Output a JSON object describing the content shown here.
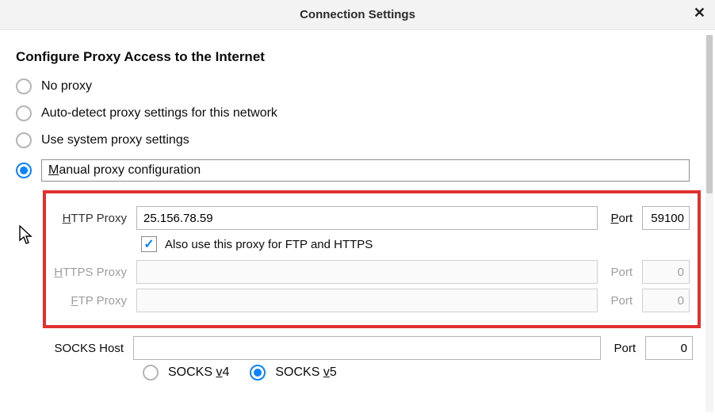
{
  "dialog": {
    "title": "Connection Settings"
  },
  "section": {
    "heading": "Configure Proxy Access to the Internet"
  },
  "radios": {
    "no_proxy": "No proxy",
    "auto_detect": "Auto-detect proxy settings for this network",
    "use_system": "Use system proxy settings",
    "manual": "Manual proxy configuration"
  },
  "http": {
    "label": "HTTP Proxy",
    "value": "25.156.78.59",
    "port_label": "Port",
    "port_value": "59100"
  },
  "also_use": {
    "label": "Also use this proxy for FTP and HTTPS",
    "checked": true
  },
  "https": {
    "label": "HTTPS Proxy",
    "value": "",
    "port_label": "Port",
    "port_value": "0"
  },
  "ftp": {
    "label": "FTP Proxy",
    "value": "",
    "port_label": "Port",
    "port_value": "0"
  },
  "socks": {
    "label": "SOCKS Host",
    "value": "",
    "port_label": "Port",
    "port_value": "0",
    "v4_label": "SOCKS v4",
    "v5_label": "SOCKS v5"
  }
}
